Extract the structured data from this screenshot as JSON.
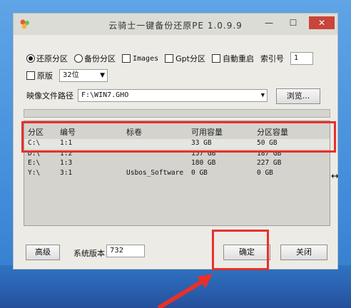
{
  "window": {
    "title": "云骑士一键备份还原PE 1.0.9.9",
    "close_label": "✕",
    "min_label": "—",
    "max_label": "☐"
  },
  "options": {
    "restore_label": "还原分区",
    "backup_label": "备份分区",
    "images_label": "Images",
    "gpt_label": "Gpt分区",
    "auto_reboot_label": "自動重启",
    "index_label": "索引号",
    "index_value": "1",
    "original_label": "原版",
    "bits_value": "32位"
  },
  "image_path": {
    "label": "映像文件路径",
    "value": "F:\\WIN7.GHO",
    "browse_label": "浏览..."
  },
  "progress": {
    "value": 0
  },
  "list": {
    "headers": [
      "分区",
      "编号",
      "标卷",
      "可用容量",
      "分区容量"
    ],
    "rows": [
      [
        "C:\\",
        "1:1",
        "",
        "33 GB",
        "50 GB"
      ],
      [
        "D:\\",
        "1:2",
        "",
        "157 GB",
        "187 GB"
      ],
      [
        "E:\\",
        "1:3",
        "",
        "180 GB",
        "227 GB"
      ],
      [
        "Y:\\",
        "3:1",
        "Usbos_Software",
        "0 GB",
        "0 GB"
      ]
    ]
  },
  "footer": {
    "advanced_label": "高级",
    "version_label": "系统版本",
    "version_value": "732",
    "ok_label": "确定",
    "close_label": "关闭"
  },
  "colors": {
    "highlight": "#e8302a",
    "desktop": "#3e8ad9"
  }
}
